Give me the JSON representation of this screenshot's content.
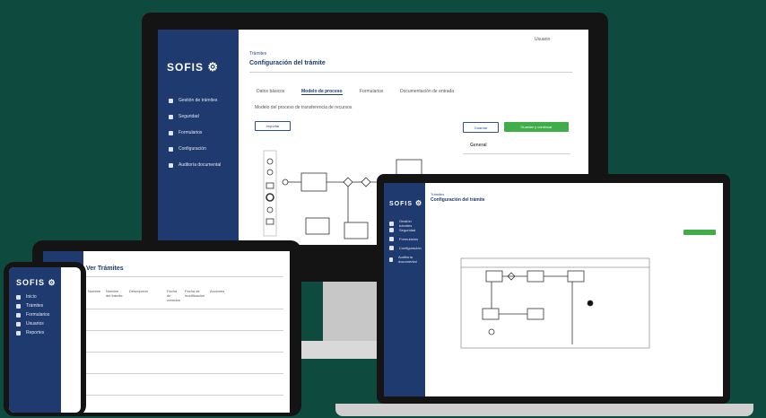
{
  "brand": {
    "logo_text": "SOFIS"
  },
  "monitor": {
    "user_menu": "Usuario",
    "breadcrumb": "Trámites",
    "page_title": "Configuración del trámite",
    "tabs": [
      "Datos básicos",
      "Modelo de proceso",
      "Formularios",
      "Documentación de entrada"
    ],
    "description": "Modelo del proceso de transferencia de recursos",
    "toolbar_left": "Importar",
    "btn_outline": "Guardar",
    "btn_green": "Guardar y continuar",
    "panel_title": "General",
    "nav": [
      "Gestión de trámites",
      "Seguridad",
      "Formularios",
      "Configuración",
      "Auditoría documental"
    ]
  },
  "laptop": {
    "breadcrumb": "Trámites",
    "page_title": "Configuración del trámite",
    "nav": [
      "Gestión trámites",
      "Seguridad",
      "Formularios",
      "Configuración",
      "Auditoría documental"
    ]
  },
  "tablet": {
    "page_title": "Ver Trámites",
    "columns": [
      "Nombre",
      "Nombre del trámite",
      "Descripción",
      "Fecha de creación",
      "Fecha de modificación",
      "Acciones"
    ]
  },
  "phone": {
    "nav": [
      "Inicio",
      "Trámites",
      "Formularios",
      "Usuarios",
      "Reportes"
    ]
  }
}
